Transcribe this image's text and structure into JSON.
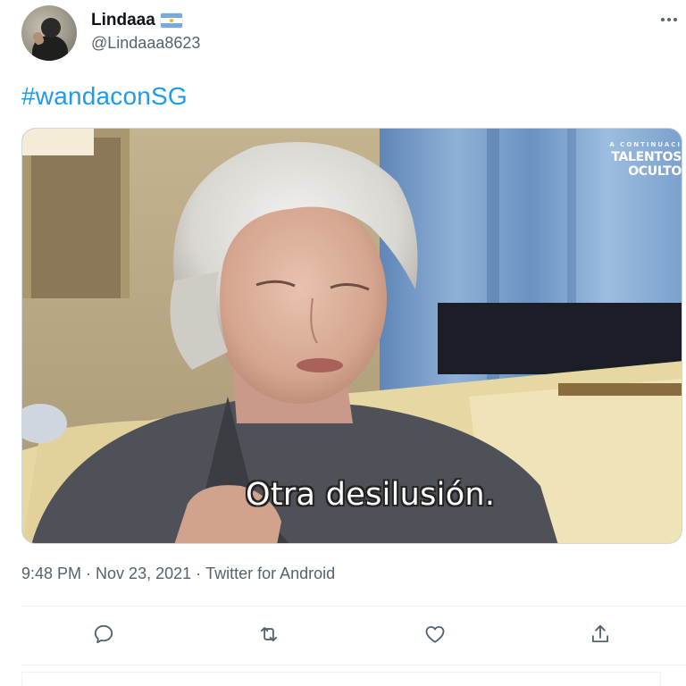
{
  "tweet": {
    "author": {
      "display_name": "Lindaaa",
      "flag_icon": "argentina-flag-icon",
      "handle": "@Lindaaa8623"
    },
    "text": "#wandaconSG",
    "media": {
      "caption": "Otra desilusión.",
      "watermark_small": "A CONTINUACI",
      "watermark_big": "TALENTOS OCULTO"
    },
    "meta": {
      "time": "9:48 PM",
      "date": "Nov 23, 2021",
      "source": "Twitter for Android",
      "separator": "·"
    },
    "actions": [
      {
        "icon": "reply-icon"
      },
      {
        "icon": "retweet-icon"
      },
      {
        "icon": "like-icon"
      },
      {
        "icon": "share-icon"
      }
    ]
  },
  "colors": {
    "link": "#1d9bf0",
    "secondary_text": "#536471",
    "primary_text": "#0f1419",
    "divider": "#eff3f4"
  }
}
